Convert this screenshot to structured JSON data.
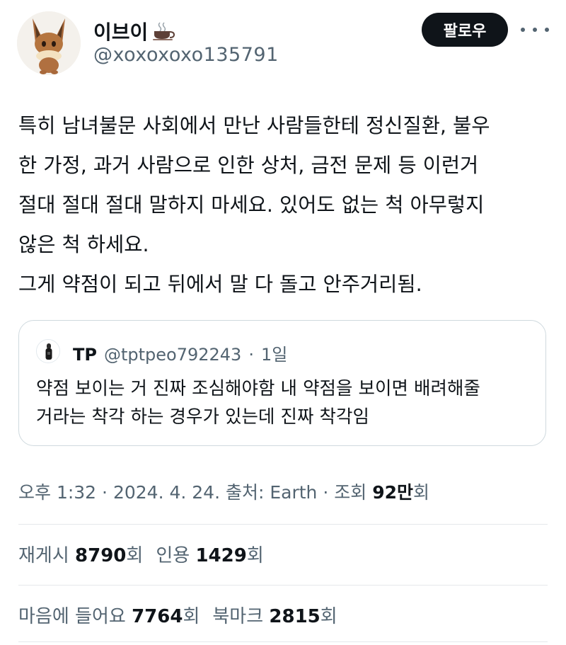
{
  "author": {
    "display_name": "이브이",
    "name_emoji": "coffee-cup-icon",
    "handle": "@xoxoxoxo135791"
  },
  "follow_label": "팔로우",
  "tweet_lines": [
    "특히 남녀불문 사회에서 만난 사람들한테 정신질환, 불우",
    "한 가정, 과거 사람으로 인한 상처, 금전 문제 등 이런거",
    "절대 절대 절대 말하지 마세요. 있어도 없는 척 아무렇지",
    "않은 척 하세요.",
    "그게 약점이 되고 뒤에서 말 다 돌고 안주거리됨."
  ],
  "quote": {
    "name": "TP",
    "handle": "@tptpeo792243",
    "separator": "·",
    "time": "1일",
    "lines": [
      "약점 보이는 거 진짜 조심해야함 내 약점을 보이면 배려해줄",
      "거라는 착각 하는 경우가 있는데 진짜 착각임"
    ]
  },
  "meta": {
    "time": "오후 1:32",
    "sep1": "·",
    "date": "2024. 4. 24.",
    "source": "출처: Earth",
    "sep2": "·",
    "views_label": "조회",
    "views_value": "92만",
    "views_unit": "회"
  },
  "stats_row1": {
    "retweets_label": "재게시",
    "retweets_value": "8790",
    "retweets_unit": "회",
    "quotes_label": "인용",
    "quotes_value": "1429",
    "quotes_unit": "회"
  },
  "stats_row2": {
    "likes_label": "마음에 들어요",
    "likes_value": "7764",
    "likes_unit": "회",
    "bookmarks_label": "북마크",
    "bookmarks_value": "2815",
    "bookmarks_unit": "회"
  },
  "colors": {
    "text": "#0f1419",
    "secondary": "#536471",
    "border": "#cfd9de",
    "button": "#0f1419"
  }
}
